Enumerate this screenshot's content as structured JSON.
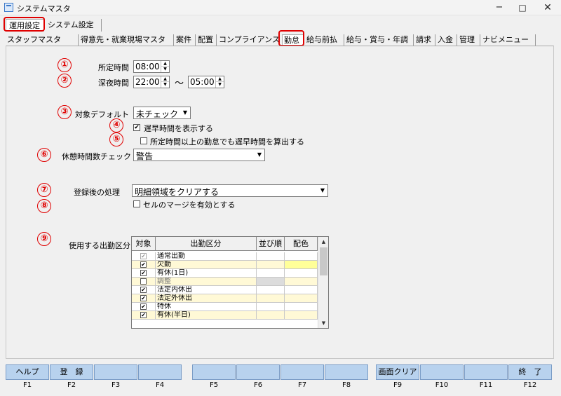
{
  "window": {
    "title": "システムマスタ",
    "minimize": "−",
    "maximize": "□",
    "close": "✕"
  },
  "top_tabs": [
    "運用設定",
    "システム設定"
  ],
  "sub_tabs": [
    "スタッフマスタ",
    "得意先・就業現場マスタ",
    "案件",
    "配置",
    "コンプライアンス",
    "勤怠",
    "給与前払",
    "給与・賞与・年調",
    "請求",
    "入金",
    "管理",
    "ナビメニュー"
  ],
  "badges": [
    "①",
    "②",
    "③",
    "④",
    "⑤",
    "⑥",
    "⑦",
    "⑧",
    "⑨"
  ],
  "form": {
    "shotei_label": "所定時間",
    "shotei_value": "08:00",
    "shinya_label": "深夜時間",
    "shinya_start": "22:00",
    "tilde": "～",
    "shinya_end": "05:00",
    "taisho_label": "対象デフォルト",
    "taisho_value": "未チェック",
    "chisou_label": "遅早時間を表示する",
    "chisou_checked": "✔",
    "shotei_ijo_label": "所定時間以上の勤怠でも遅早時間を算出する",
    "kyukei_label": "休憩時間数チェック",
    "kyukei_value": "警告",
    "toroku_label": "登録後の処理",
    "toroku_value": "明細領域をクリアする",
    "cell_label": "セルのマージを有効とする",
    "shukkin_label": "使用する出勤区分"
  },
  "grid": {
    "headers": [
      "対象",
      "出勤区分",
      "並び順",
      "配色"
    ],
    "rows": [
      {
        "check": "✔",
        "name": "通常出勤",
        "disabled": true
      },
      {
        "check": "✔",
        "name": "欠勤",
        "disabled": false
      },
      {
        "check": "✔",
        "name": "有休(1日)",
        "disabled": false
      },
      {
        "check": "",
        "name": "調整",
        "disabled": false
      },
      {
        "check": "✔",
        "name": "法定内休出",
        "disabled": false
      },
      {
        "check": "✔",
        "name": "法定外休出",
        "disabled": false
      },
      {
        "check": "✔",
        "name": "特休",
        "disabled": false
      },
      {
        "check": "✔",
        "name": "有休(半日)",
        "disabled": false
      }
    ]
  },
  "fkeys": [
    {
      "label": "ヘルプ",
      "key": "F1"
    },
    {
      "label": "登　録",
      "key": "F2"
    },
    {
      "label": "",
      "key": "F3"
    },
    {
      "label": "",
      "key": "F4"
    },
    {
      "label": "",
      "key": "F5"
    },
    {
      "label": "",
      "key": "F6"
    },
    {
      "label": "",
      "key": "F7"
    },
    {
      "label": "",
      "key": "F8"
    },
    {
      "label": "画面クリア",
      "key": "F9"
    },
    {
      "label": "",
      "key": "F10"
    },
    {
      "label": "",
      "key": "F11"
    },
    {
      "label": "終　了",
      "key": "F12"
    }
  ],
  "colors": {
    "highlight": "#e00000",
    "row_yellow": "#fff9d6",
    "color_cell_yellow": "#ffff99",
    "fkey_bg": "#b8d2ee"
  }
}
